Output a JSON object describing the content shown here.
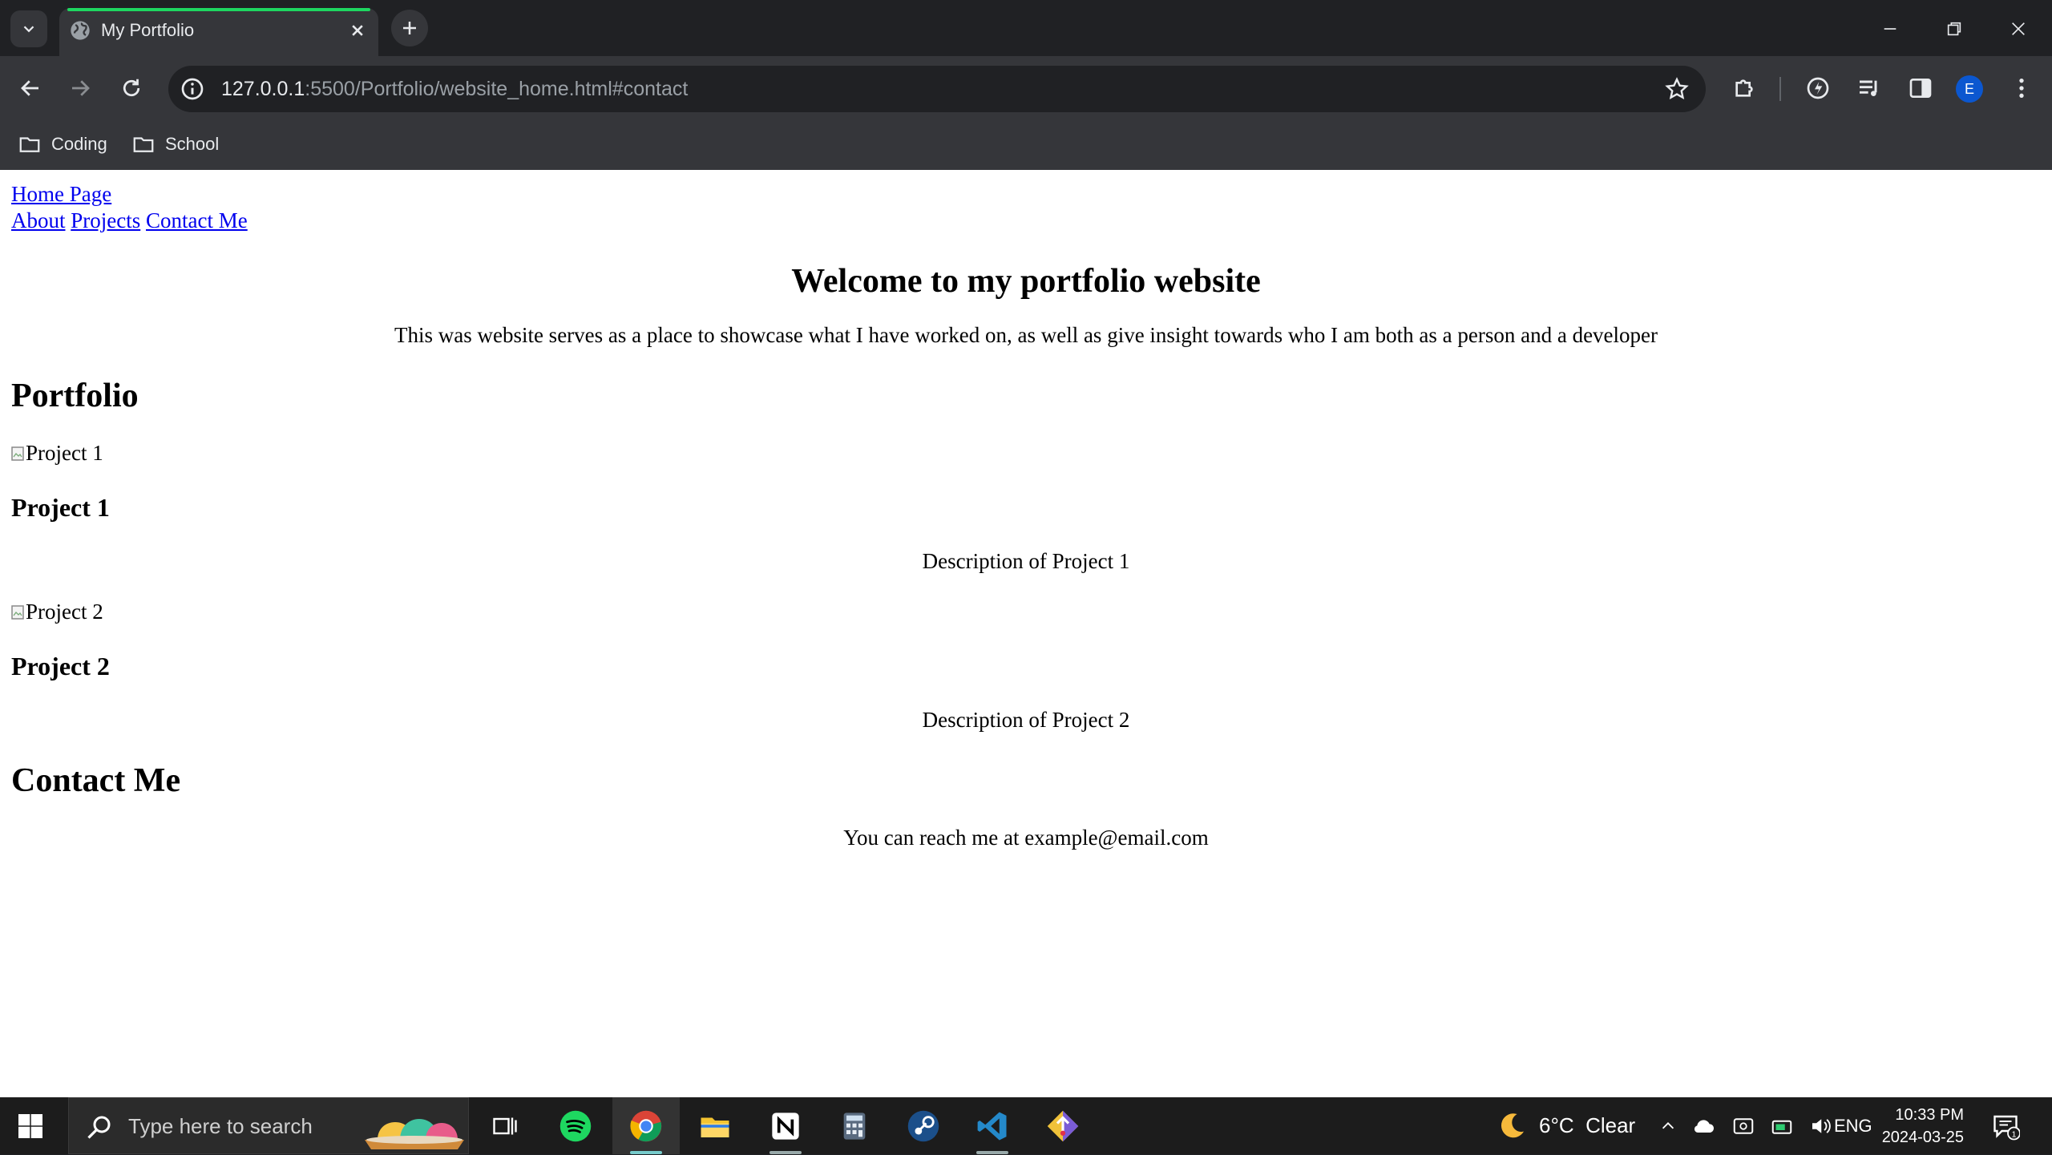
{
  "browser": {
    "tab_title": "My Portfolio",
    "url_host": "127.0.0.1",
    "url_rest": ":5500/Portfolio/website_home.html#contact",
    "profile_initial": "E",
    "bookmarks": [
      "Coding",
      "School"
    ],
    "colors": {
      "frame": "#202124",
      "toolbar": "#35363a",
      "tab_progress": "#1ed760",
      "avatar": "#0b57d0"
    }
  },
  "page": {
    "nav_home": "Home Page",
    "nav_links": [
      "About",
      "Projects",
      "Contact Me"
    ],
    "welcome": "Welcome to my portfolio website",
    "intro": "This was website serves as a place to showcase what I have worked on, as well as give insight towards who I am both as a person and a developer",
    "portfolio_heading": "Portfolio",
    "projects": [
      {
        "img_alt": "Project 1",
        "title": "Project 1",
        "description": "Description of Project 1"
      },
      {
        "img_alt": "Project 2",
        "title": "Project 2",
        "description": "Description of Project 2"
      }
    ],
    "contact_heading": "Contact Me",
    "contact_text": "You can reach me at example@email.com"
  },
  "taskbar": {
    "search_placeholder": "Type here to search",
    "apps": [
      "task-view-icon",
      "spotify-icon",
      "chrome-icon",
      "file-explorer-icon",
      "notion-icon",
      "calculator-icon",
      "steam-icon",
      "vscode-icon",
      "git-icon"
    ],
    "weather": "6°C  Clear",
    "language": "ENG",
    "time": "10:33 PM",
    "date": "2024-03-25",
    "notification_count": "1"
  }
}
